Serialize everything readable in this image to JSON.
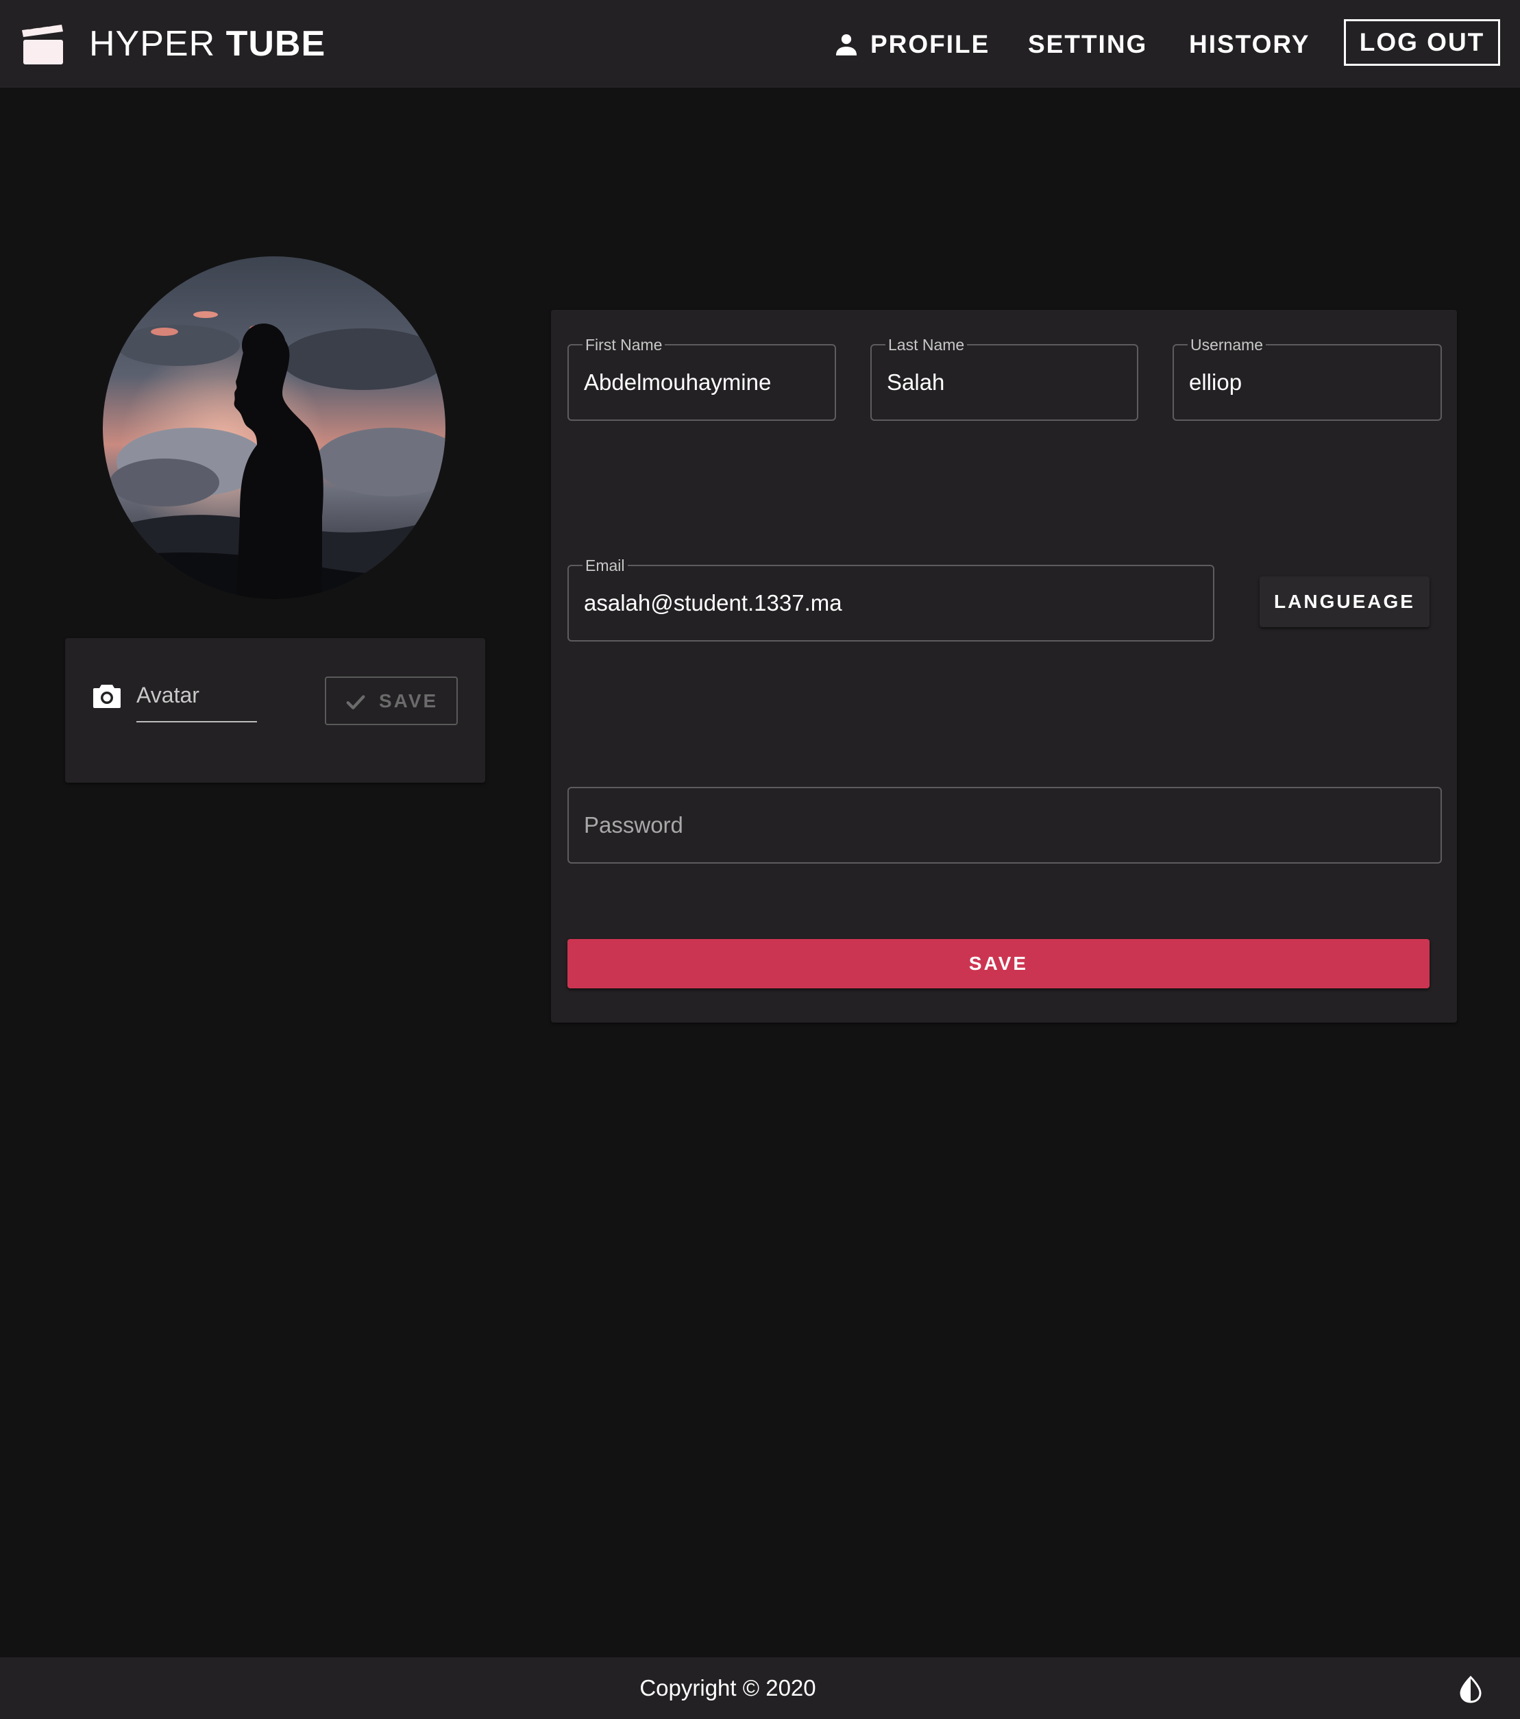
{
  "header": {
    "brand_light": "HYPER",
    "brand_bold": "TUBE",
    "nav": {
      "profile": "PROFILE",
      "setting": "SETTING",
      "history": "HISTORY",
      "logout": "LOG OUT"
    }
  },
  "avatar_panel": {
    "input_label": "Avatar",
    "save_label": "SAVE"
  },
  "form": {
    "first_name": {
      "label": "First Name",
      "value": "Abdelmouhaymine"
    },
    "last_name": {
      "label": "Last Name",
      "value": "Salah"
    },
    "username": {
      "label": "Username",
      "value": "elliop"
    },
    "email": {
      "label": "Email",
      "value": "asalah@student.1337.ma"
    },
    "language_button": "LANGUEAGE",
    "password": {
      "placeholder": "Password"
    },
    "save_button": "SAVE"
  },
  "footer": {
    "copyright": "Copyright © 2020"
  },
  "icons": {
    "logo": "clapperboard-icon",
    "profile": "person-icon",
    "avatar_upload": "camera-icon",
    "avatar_save": "check-icon",
    "theme": "contrast-drop-icon"
  },
  "colors": {
    "background": "#121212",
    "surface": "#232123",
    "accent": "#cc3551",
    "text": "#ffffff"
  }
}
